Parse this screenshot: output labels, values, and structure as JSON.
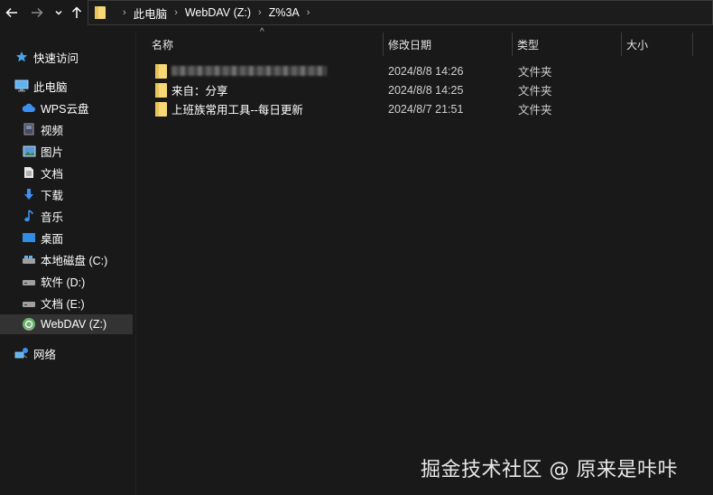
{
  "addressbar": {
    "crumbs": [
      "此电脑",
      "WebDAV (Z:)",
      "Z%3A"
    ]
  },
  "sidebar": {
    "items": [
      {
        "label": "快速访问",
        "icon": "star-icon"
      },
      {
        "label": "此电脑",
        "icon": "computer-icon"
      },
      {
        "label": "WPS云盘",
        "icon": "cloud-icon"
      },
      {
        "label": "视频",
        "icon": "video-icon"
      },
      {
        "label": "图片",
        "icon": "picture-icon"
      },
      {
        "label": "文档",
        "icon": "document-icon"
      },
      {
        "label": "下载",
        "icon": "download-icon"
      },
      {
        "label": "音乐",
        "icon": "music-icon"
      },
      {
        "label": "桌面",
        "icon": "desktop-icon"
      },
      {
        "label": "本地磁盘 (C:)",
        "icon": "drive-icon"
      },
      {
        "label": "软件 (D:)",
        "icon": "drive-icon"
      },
      {
        "label": "文档 (E:)",
        "icon": "drive-icon"
      },
      {
        "label": "WebDAV (Z:)",
        "icon": "network-drive-icon"
      },
      {
        "label": "网络",
        "icon": "network-icon"
      }
    ]
  },
  "columns": {
    "name": "名称",
    "date": "修改日期",
    "type": "类型",
    "size": "大小"
  },
  "files": [
    {
      "name": "",
      "date": "2024/8/8 14:26",
      "type": "文件夹"
    },
    {
      "name": "来自：分享",
      "date": "2024/8/8 14:25",
      "type": "文件夹"
    },
    {
      "name": "上班族常用工具--每日更新",
      "date": "2024/8/7 21:51",
      "type": "文件夹"
    }
  ],
  "watermark": "掘金技术社区 @ 原来是咔咔",
  "colors": {
    "background": "#191919",
    "selected": "#333333",
    "folder": "#f8d775"
  }
}
